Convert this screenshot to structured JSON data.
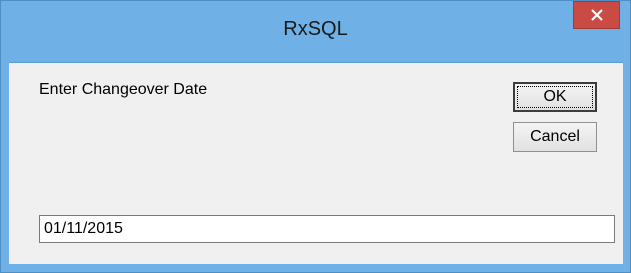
{
  "window": {
    "title": "RxSQL",
    "close_glyph": "×",
    "close_icon": "close-icon",
    "title_bar_color": "#6fb1e6",
    "close_button_color": "#c94b43"
  },
  "dialog": {
    "prompt": "Enter Changeover Date",
    "ok_label": "OK",
    "cancel_label": "Cancel",
    "date_value": "01/11/2015"
  }
}
